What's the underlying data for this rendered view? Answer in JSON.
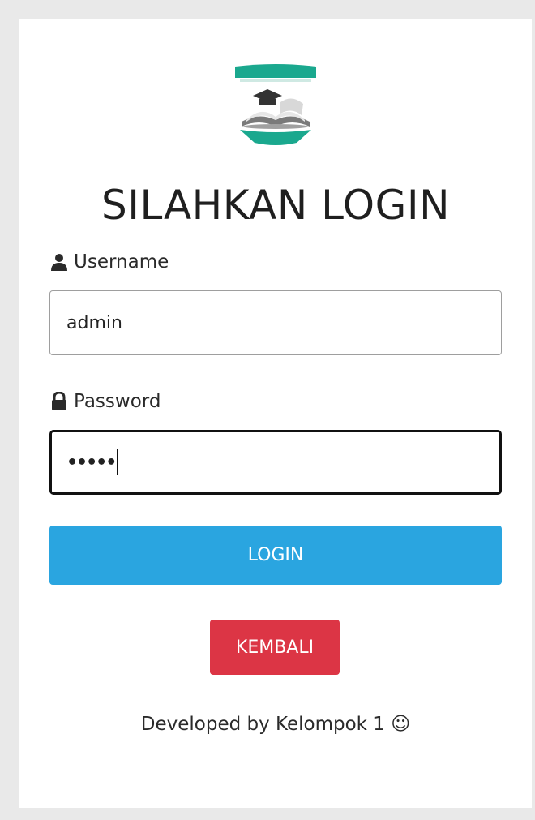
{
  "form": {
    "title": "SILAHKAN LOGIN",
    "username_label": "Username",
    "username_value": "admin",
    "password_label": "Password",
    "password_masked": "•••••",
    "login_button": "LOGIN",
    "back_button": "KEMBALI"
  },
  "footer": {
    "text": "Developed by Kelompok 1 ☺"
  },
  "icons": {
    "username": "user-icon",
    "password": "lock-icon",
    "logo": "school-logo"
  },
  "colors": {
    "login_button": "#2aa5e0",
    "back_button": "#dc3545",
    "logo_accent": "#1aa88e"
  }
}
